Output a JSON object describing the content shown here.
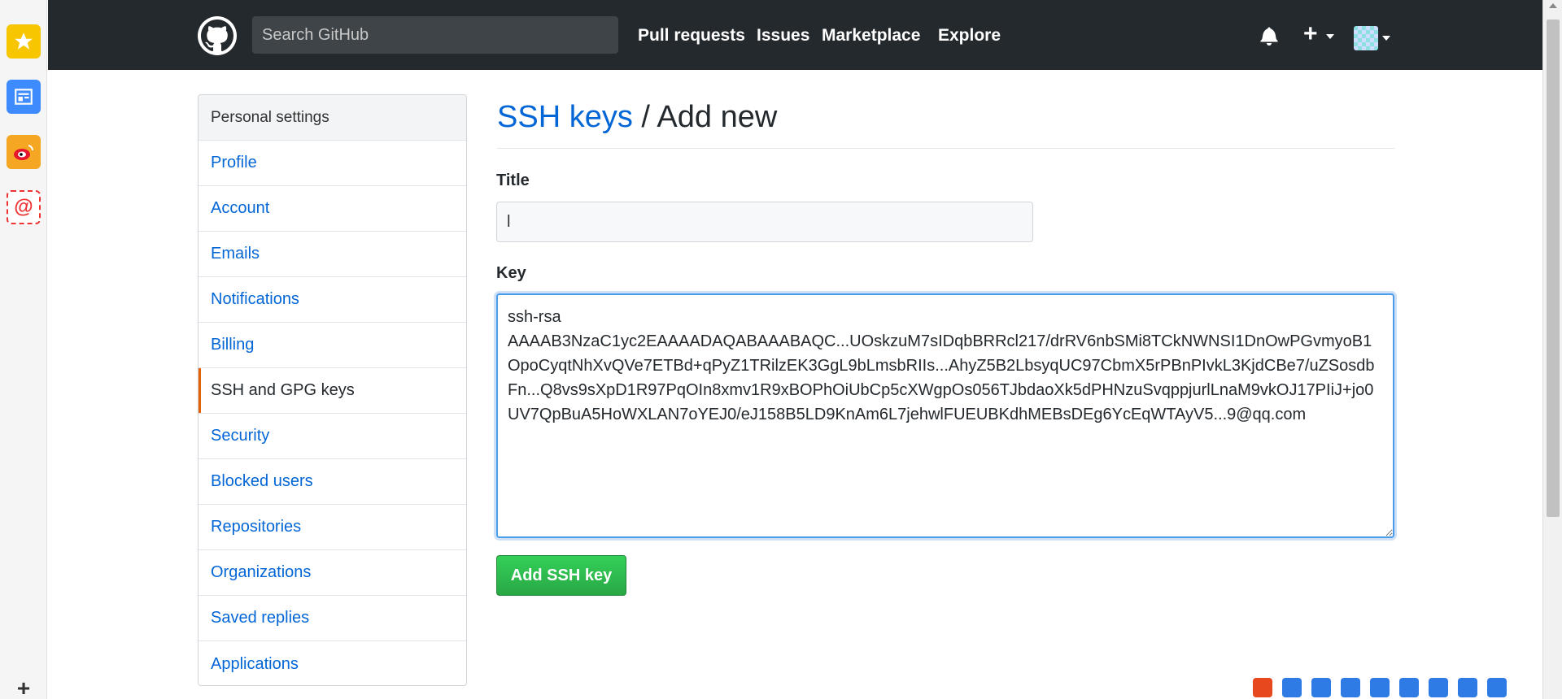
{
  "header": {
    "search_placeholder": "Search GitHub",
    "nav": [
      "Pull requests",
      "Issues",
      "Marketplace",
      "Explore"
    ]
  },
  "sidebar": {
    "heading": "Personal settings",
    "items": [
      {
        "label": "Profile"
      },
      {
        "label": "Account"
      },
      {
        "label": "Emails"
      },
      {
        "label": "Notifications"
      },
      {
        "label": "Billing"
      },
      {
        "label": "SSH and GPG keys",
        "selected": true
      },
      {
        "label": "Security"
      },
      {
        "label": "Blocked users"
      },
      {
        "label": "Repositories"
      },
      {
        "label": "Organizations"
      },
      {
        "label": "Saved replies"
      },
      {
        "label": "Applications"
      }
    ]
  },
  "main": {
    "title_link": "SSH keys",
    "title_rest": " / Add new",
    "title_label": "Title",
    "title_value": "l",
    "key_label": "Key",
    "key_value": "ssh-rsa\nAAAAB3NzaC1yc2EAAAADAQABAAABAQC...UOskzuM7sIDqbBRRcl217/drRV6nbSMi8TCkNWNSI1DnOwPGvmyoB1OpoCyqtNhXvQVe7ETBd+qPyZ1TRilzEK3GgL9bLmsbRIIs...AhyZ5B2LbsyqUC97CbmX5rPBnPIvkL3KjdCBe7/uZSosdbFn...Q8vs9sXpD1R97PqOIn8xmv1R9xBOPhOiUbCp5cXWgpOs056TJbdaoXk5dPHNzuSvqppjurlLnaM9vkOJ17PIiJ+jo0UV7QpBuA5HoWXLAN7oYEJ0/eJ158B5LD9KnAm6L7jehwlFUEUBKdhMEBsDEg6YcEqWTAyV5...9@qq.com",
    "submit_label": "Add SSH key"
  }
}
